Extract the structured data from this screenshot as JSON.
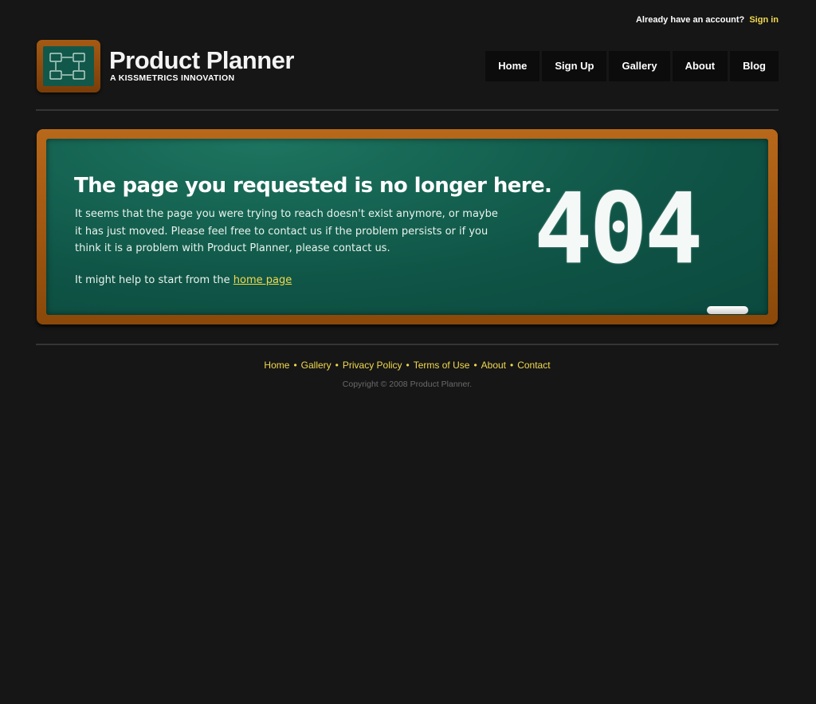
{
  "topbar": {
    "prompt": "Already have an account?",
    "signin": "Sign in"
  },
  "brand": {
    "title": "Product Planner",
    "subtitle": "A KISSMETRICS INNOVATION",
    "logo_icon": "flowchart-board-icon"
  },
  "nav": [
    "Home",
    "Sign Up",
    "Gallery",
    "About",
    "Blog"
  ],
  "error": {
    "title": "The page you requested is no longer here.",
    "body": "It seems that the page you were trying to reach doesn't exist anymore, or maybe it has just moved. Please feel free to contact us if the problem persists or if you think it is a problem with Product Planner, please contact us.",
    "help_prefix": "It might help to start from the",
    "help_link": "home page",
    "code": "404"
  },
  "footer": {
    "links": [
      "Home",
      "Gallery",
      "Privacy Policy",
      "Terms of Use",
      "About",
      "Contact"
    ],
    "copyright": "Copyright © 2008 Product Planner."
  },
  "colors": {
    "background": "#161616",
    "accent_yellow": "#f2d94e",
    "board_green": "#0f5446",
    "frame_wood": "#a55a14"
  }
}
